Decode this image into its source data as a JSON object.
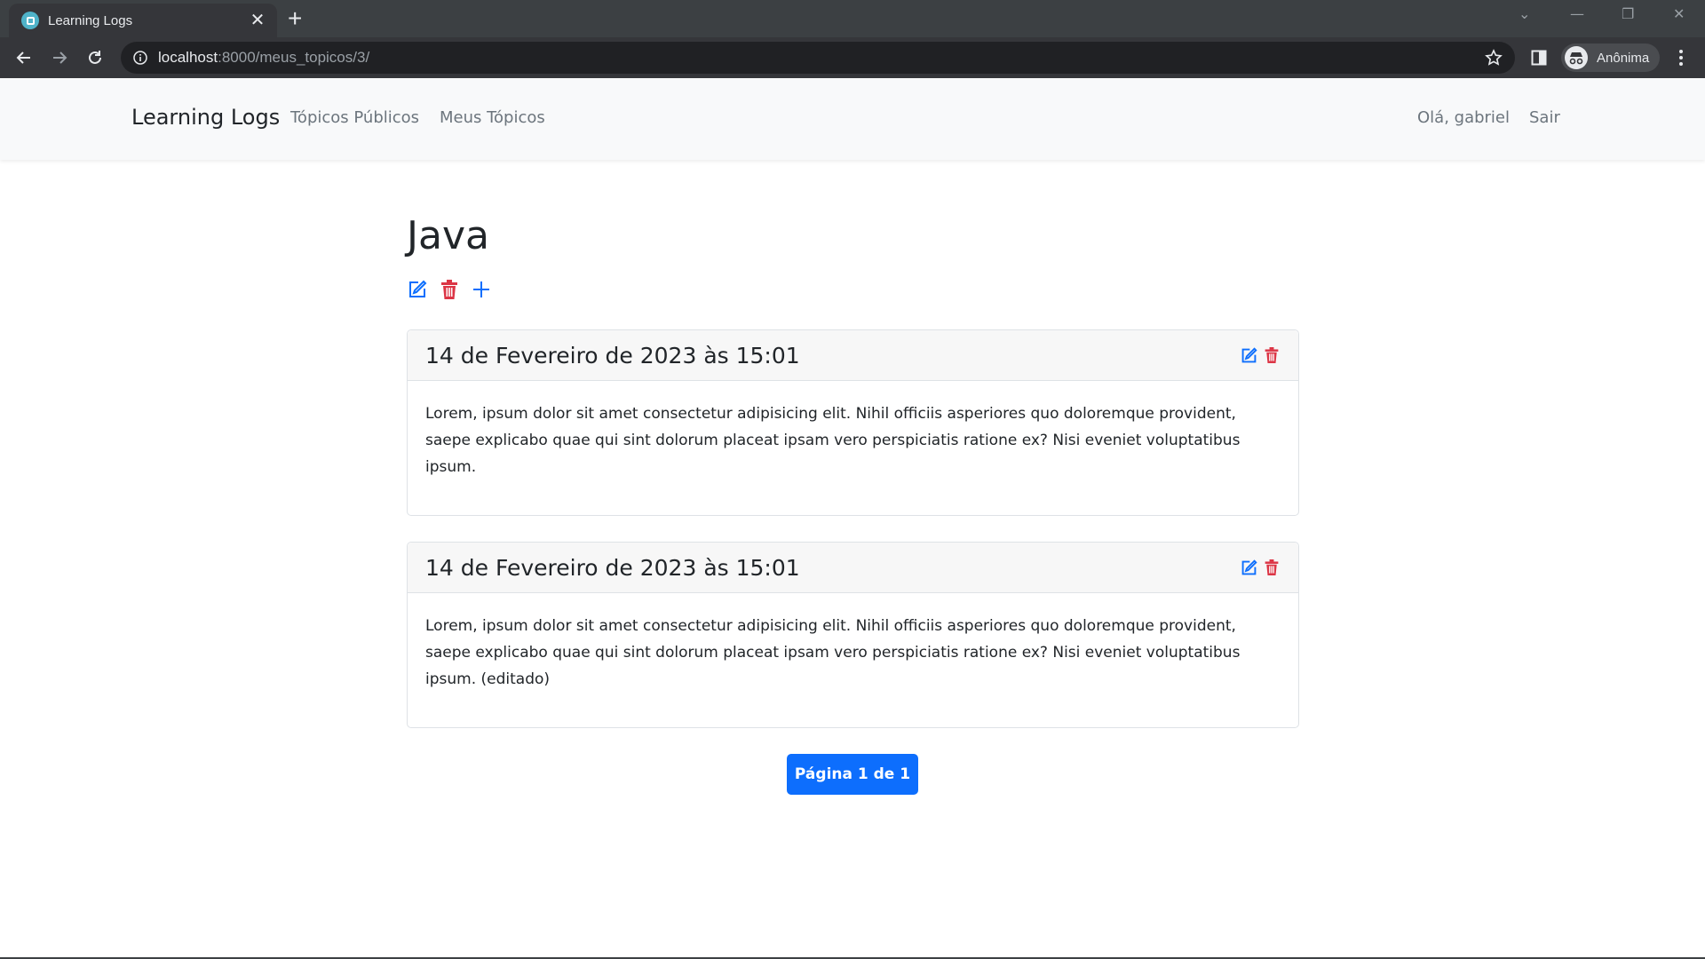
{
  "browser": {
    "tab_title": "Learning Logs",
    "tab_close": "✕",
    "new_tab": "+",
    "url_host": "localhost",
    "url_path": ":8000/meus_topicos/3/",
    "profile_label": "Anônima"
  },
  "navbar": {
    "brand": "Learning Logs",
    "links": [
      "Tópicos Públicos",
      "Meus Tópicos"
    ],
    "greeting": "Olá, gabriel",
    "logout": "Sair"
  },
  "topic": {
    "title": "Java"
  },
  "entries": [
    {
      "date": "14 de Fevereiro de 2023 às 15:01",
      "text": "Lorem, ipsum dolor sit amet consectetur adipisicing elit. Nihil officiis asperiores quo doloremque provident, saepe explicabo quae qui sint dolorum placeat ipsam vero perspiciatis ratione ex? Nisi eveniet voluptatibus ipsum."
    },
    {
      "date": "14 de Fevereiro de 2023 às 15:01",
      "text": "Lorem, ipsum dolor sit amet consectetur adipisicing elit. Nihil officiis asperiores quo doloremque provident, saepe explicabo quae qui sint dolorum placeat ipsam vero perspiciatis ratione ex? Nisi eveniet voluptatibus ipsum. (editado)"
    }
  ],
  "pagination": {
    "label": "Página 1 de 1"
  },
  "icons": {
    "edit": "edit-icon",
    "delete": "trash-icon",
    "add": "plus-icon"
  },
  "colors": {
    "primary": "#0d6efd",
    "danger": "#dc3545",
    "navbar_bg": "#f8f9fa",
    "chrome_bg": "#35363a"
  }
}
